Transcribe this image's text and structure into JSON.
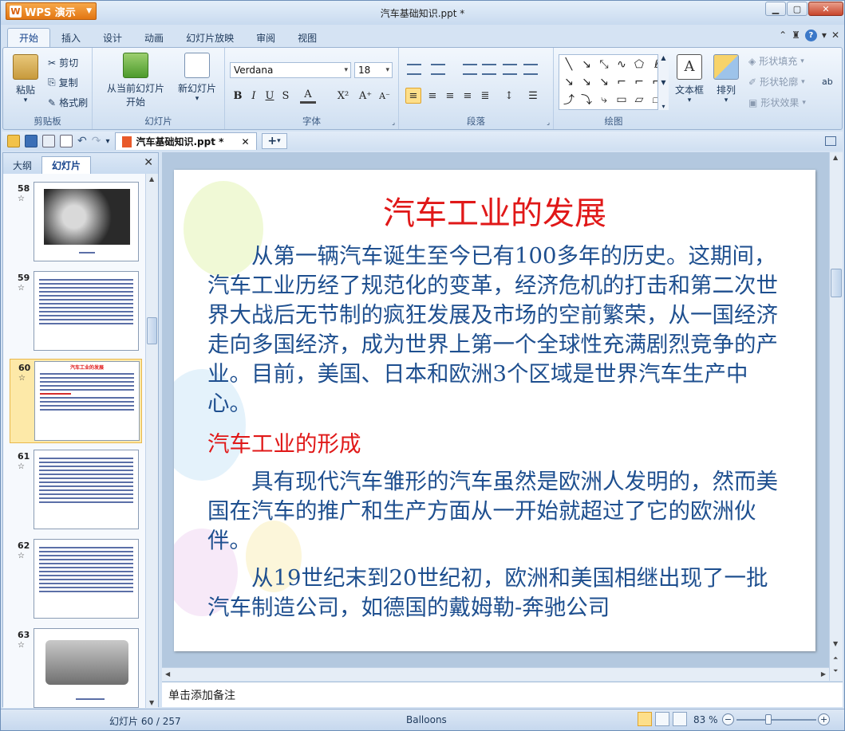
{
  "app": {
    "menu_button": "WPS 演示",
    "window_title": "汽车基础知识.ppt *"
  },
  "tabs": [
    "开始",
    "插入",
    "设计",
    "动画",
    "幻灯片放映",
    "审阅",
    "视图"
  ],
  "ribbon": {
    "clipboard": {
      "paste": "粘贴",
      "cut": "剪切",
      "copy": "复制",
      "format_painter": "格式刷",
      "label": "剪贴板"
    },
    "slides": {
      "from_current": "从当前幻灯片",
      "start": "开始",
      "new_slide": "新幻灯片",
      "label": "幻灯片"
    },
    "font": {
      "name": "Verdana",
      "size": "18",
      "label": "字体"
    },
    "paragraph": {
      "label": "段落"
    },
    "drawing": {
      "textbox": "文本框",
      "arrange": "排列",
      "shape_fill": "形状填充",
      "shape_outline": "形状轮廓",
      "shape_effects": "形状效果",
      "label": "绘图"
    }
  },
  "document_tab": {
    "name": "汽车基础知识.ppt *"
  },
  "panel": {
    "tab_outline": "大纲",
    "tab_slides": "幻灯片",
    "thumbnails": [
      {
        "num": "58",
        "star": "☆"
      },
      {
        "num": "59",
        "star": "☆"
      },
      {
        "num": "60",
        "star": "☆",
        "title": "汽车工业的发展"
      },
      {
        "num": "61",
        "star": "☆"
      },
      {
        "num": "62",
        "star": "☆"
      },
      {
        "num": "63",
        "star": "☆"
      }
    ]
  },
  "slide": {
    "title": "汽车工业的发展",
    "para1": "从第一辆汽车诞生至今已有100多年的历史。这期间，汽车工业历经了规范化的变革，经济危机的打击和第二次世界大战后无节制的疯狂发展及市场的空前繁荣，从一国经济走向多国经济，成为世界上第一个全球性充满剧烈竞争的产业。目前，美国、日本和欧洲3个区域是世界汽车生产中心。",
    "subtitle": "汽车工业的形成",
    "para2": "具有现代汽车雏形的汽车虽然是欧洲人发明的，然而美国在汽车的推广和生产方面从一开始就超过了它的欧洲伙伴。",
    "para3": "从19世纪末到20世纪初，欧洲和美国相继出现了一批汽车制造公司，如德国的戴姆勒-奔驰公司"
  },
  "notes_placeholder": "单击添加备注",
  "status": {
    "slide_counter": "幻灯片 60 / 257",
    "theme": "Balloons",
    "zoom": "83 %"
  }
}
